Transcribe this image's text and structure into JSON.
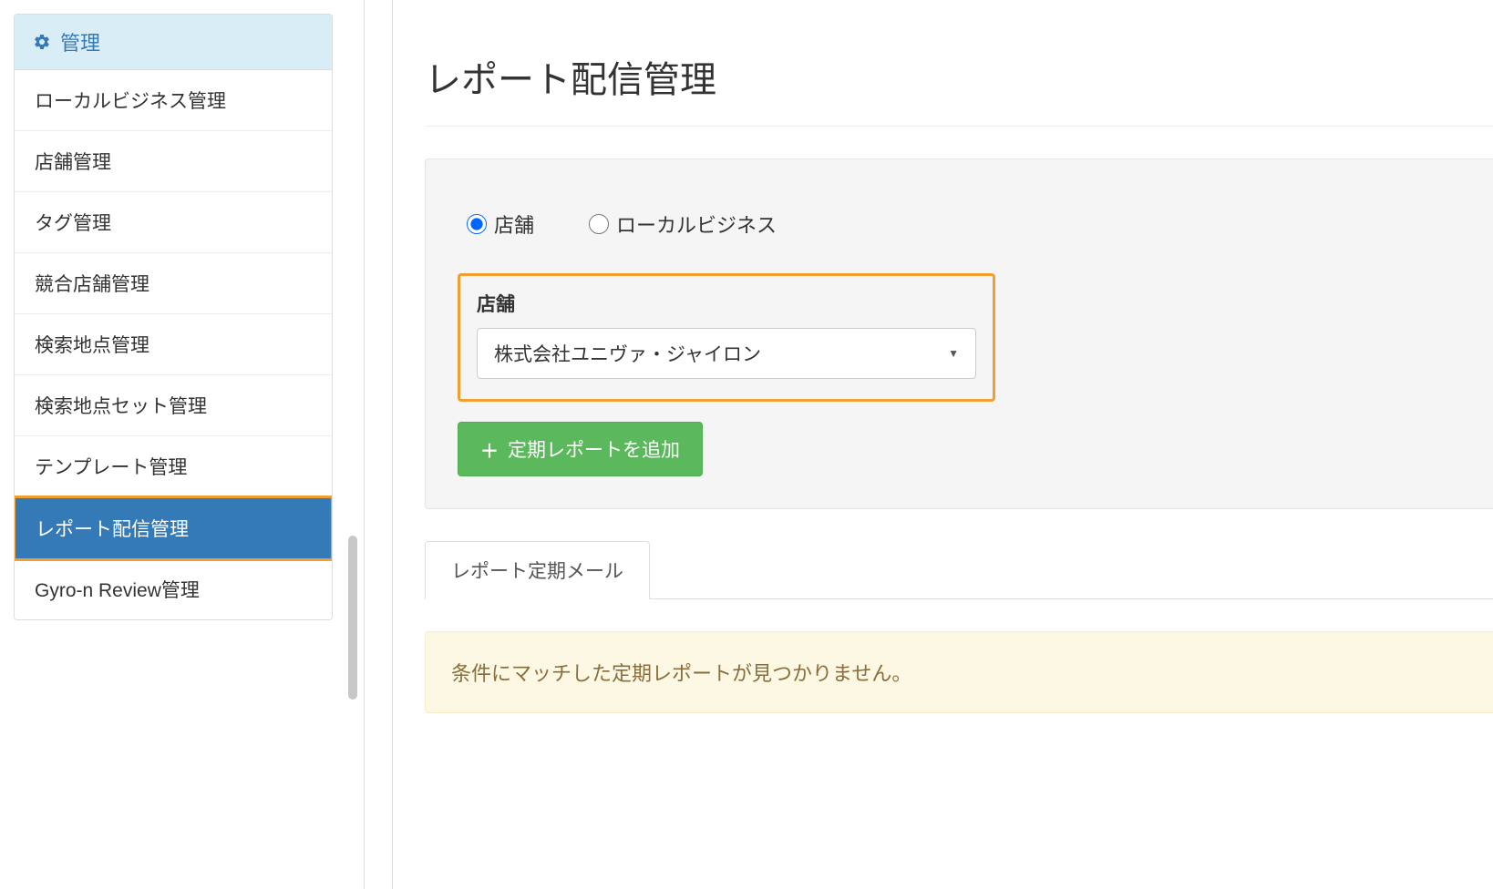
{
  "sidebar": {
    "header_label": "管理",
    "items": [
      {
        "label": "ローカルビジネス管理",
        "active": false
      },
      {
        "label": "店舗管理",
        "active": false
      },
      {
        "label": "タグ管理",
        "active": false
      },
      {
        "label": "競合店舗管理",
        "active": false
      },
      {
        "label": "検索地点管理",
        "active": false
      },
      {
        "label": "検索地点セット管理",
        "active": false
      },
      {
        "label": "テンプレート管理",
        "active": false
      },
      {
        "label": "レポート配信管理",
        "active": true
      },
      {
        "label": "Gyro-n Review管理",
        "active": false
      }
    ]
  },
  "main": {
    "page_title": "レポート配信管理",
    "radio": {
      "option1": "店舗",
      "option2": "ローカルビジネス"
    },
    "field": {
      "label": "店舗",
      "select_value": "株式会社ユニヴァ・ジャイロン"
    },
    "add_button": "定期レポートを追加",
    "tab_label": "レポート定期メール",
    "warning_message": "条件にマッチした定期レポートが見つかりません。"
  }
}
